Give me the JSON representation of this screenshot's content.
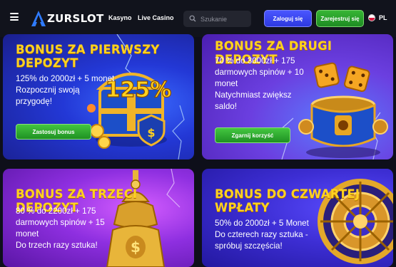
{
  "header": {
    "logo_text": "ZURSLOT",
    "nav": [
      {
        "label": "Kasyno"
      },
      {
        "label": "Live Casino"
      }
    ],
    "search": {
      "placeholder": "Szukanie"
    },
    "login_label": "Zaloguj się",
    "register_label": "Zarejestruj się",
    "language": "PL",
    "colors": {
      "login": "#3a45f0",
      "register": "#2ca02c",
      "accent": "#ffd21f"
    }
  },
  "bonuses": [
    {
      "title": "BONUS ZA PIERWSZY DEPOZYT",
      "title_line1": "BONUS ZA PIERWSZY",
      "title_line2": "DEPOZYT",
      "desc_lines": [
        "125% do 2000zł + 5 monet",
        "Rozpocznij swoją",
        "przygodę!"
      ],
      "button_label": "Zastosuj bonus",
      "art_text": "125%",
      "art_icon": "treasure-chest-icon"
    },
    {
      "title": "BONUS ZA DRUGI DEPOZYT",
      "title_line1": "BONUS ZA DRUGI DEPOZYT",
      "desc_lines": [
        "70 % do 3000zł + 175",
        "darmowych spinów + 10",
        "monet",
        "Natychmiast zwiększ",
        "saldo!"
      ],
      "button_label": "Zgarnij korzyść",
      "art_icon": "dice-pot-icon"
    },
    {
      "title": "BONUS ZA TRZECI DEPOZYT",
      "title_line1": "BONUS ZA TRZECI DEPOZYT",
      "desc_lines": [
        "80 % do 2200zł + 175",
        "darmowych spinów + 15",
        "monet",
        "Do trzech razy sztuka!"
      ],
      "art_icon": "golden-bell-icon"
    },
    {
      "title": "BONUS DO CZWARTEJ WPŁATY",
      "title_line1": "BONUS DO CZWARTEJ",
      "title_line2": "WPŁATY",
      "desc_lines": [
        "50% do 2000zł + 5 Monet",
        "Do czterech razy sztuka -",
        "spróbuj szczęścia!"
      ],
      "art_icon": "golden-wheel-icon"
    }
  ]
}
